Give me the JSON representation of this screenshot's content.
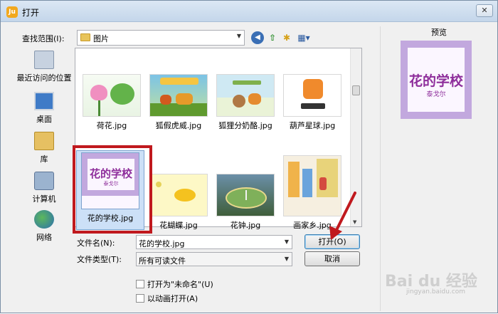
{
  "window": {
    "title": "打开"
  },
  "lookin": {
    "label": "查找范围(I):",
    "value": "图片"
  },
  "toolbar": {
    "icons": [
      "back-icon",
      "up-folder-icon",
      "new-folder-icon",
      "view-menu-icon"
    ]
  },
  "places": [
    {
      "label": "最近访问的位置",
      "icon": "recent-places-icon"
    },
    {
      "label": "桌面",
      "icon": "desktop-icon"
    },
    {
      "label": "库",
      "icon": "library-icon"
    },
    {
      "label": "计算机",
      "icon": "computer-icon"
    },
    {
      "label": "网络",
      "icon": "network-icon"
    }
  ],
  "files": [
    {
      "name": "荷花.jpg"
    },
    {
      "name": "狐假虎威.jpg"
    },
    {
      "name": "狐狸分奶酪.jpg"
    },
    {
      "name": "葫芦星球.jpg"
    },
    {
      "name": "花的学校.jpg",
      "selected": true,
      "thumb_title": "花的学校",
      "thumb_sub": "泰戈尔"
    },
    {
      "name": "花蝴蝶.jpg"
    },
    {
      "name": "花钟.jpg"
    },
    {
      "name": "画家乡.jpg"
    }
  ],
  "filename": {
    "label": "文件名(N):",
    "value": "花的学校.jpg"
  },
  "filetype": {
    "label": "文件类型(T):",
    "value": "所有可读文件"
  },
  "buttons": {
    "open": "打开(O)",
    "cancel": "取消"
  },
  "options": [
    {
      "label": "打开为\"未命名\"(U)",
      "checked": false
    },
    {
      "label": "以动画打开(A)",
      "checked": false
    }
  ],
  "preview": {
    "label": "预览",
    "title": "花的学校",
    "subtitle": "泰戈尔"
  },
  "watermark": {
    "logo": "Bai du 经验",
    "sub": "jingyan.baidu.com"
  },
  "colors": {
    "annotation_red": "#c0191e",
    "selection_blue": "#cce0f7"
  }
}
